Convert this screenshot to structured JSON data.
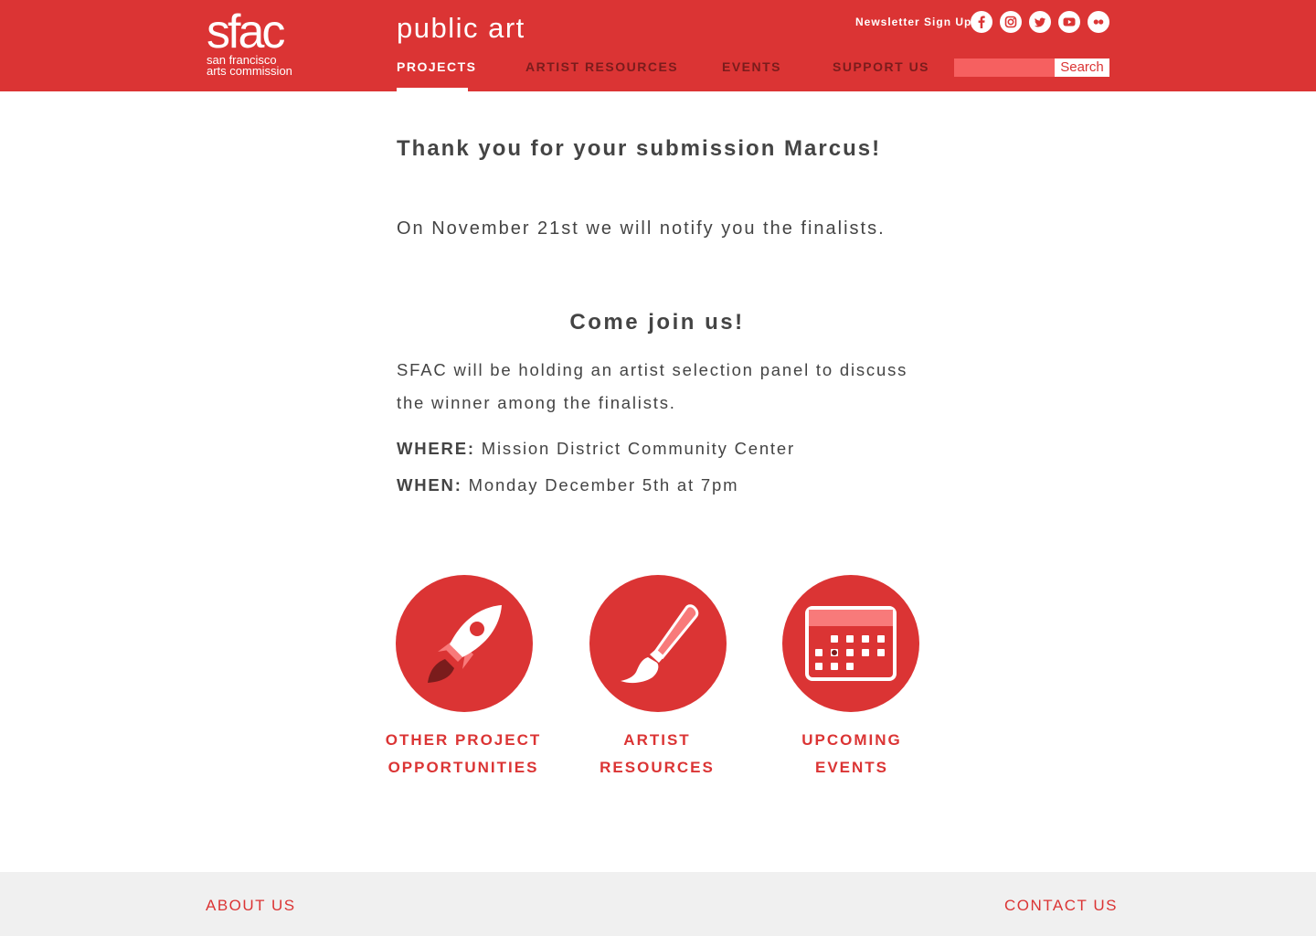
{
  "header": {
    "logo": {
      "mark": "sfac",
      "line1": "san francisco",
      "line2": "arts commission"
    },
    "site_title": "public art",
    "newsletter": "Newsletter Sign Up",
    "social": [
      "facebook-icon",
      "instagram-icon",
      "twitter-icon",
      "youtube-icon",
      "flickr-icon"
    ],
    "nav": [
      {
        "label": "PROJECTS",
        "active": true
      },
      {
        "label": "ARTIST RESOURCES",
        "active": false
      },
      {
        "label": "EVENTS",
        "active": false
      },
      {
        "label": "SUPPORT US",
        "active": false
      }
    ],
    "search": {
      "value": "",
      "placeholder": "",
      "button_label": "Search"
    }
  },
  "main": {
    "heading": "Thank you for your submission Marcus!",
    "notify": "On November 21st we will notify you the finalists.",
    "join_heading": "Come join us!",
    "panel_text": "SFAC will be holding an artist selection panel to discuss the winner among the finalists.",
    "where_label": "WHERE:",
    "where_value": "Mission District Community Center",
    "when_label": "WHEN:",
    "when_value": "Monday December 5th at 7pm",
    "links": [
      {
        "icon": "rocket-icon",
        "line1": "OTHER PROJECT",
        "line2": "OPPORTUNITIES"
      },
      {
        "icon": "paintbrush-icon",
        "line1": "ARTIST",
        "line2": "RESOURCES"
      },
      {
        "icon": "calendar-icon",
        "line1": "UPCOMING",
        "line2": "EVENTS"
      }
    ]
  },
  "footer": {
    "left": "ABOUT US",
    "right": "CONTACT US"
  },
  "colors": {
    "brand_red": "#db3434",
    "dark_red": "#7a1c1c",
    "light_red": "#f66060",
    "text": "#444444",
    "footer_bg": "#f0f0f0"
  }
}
